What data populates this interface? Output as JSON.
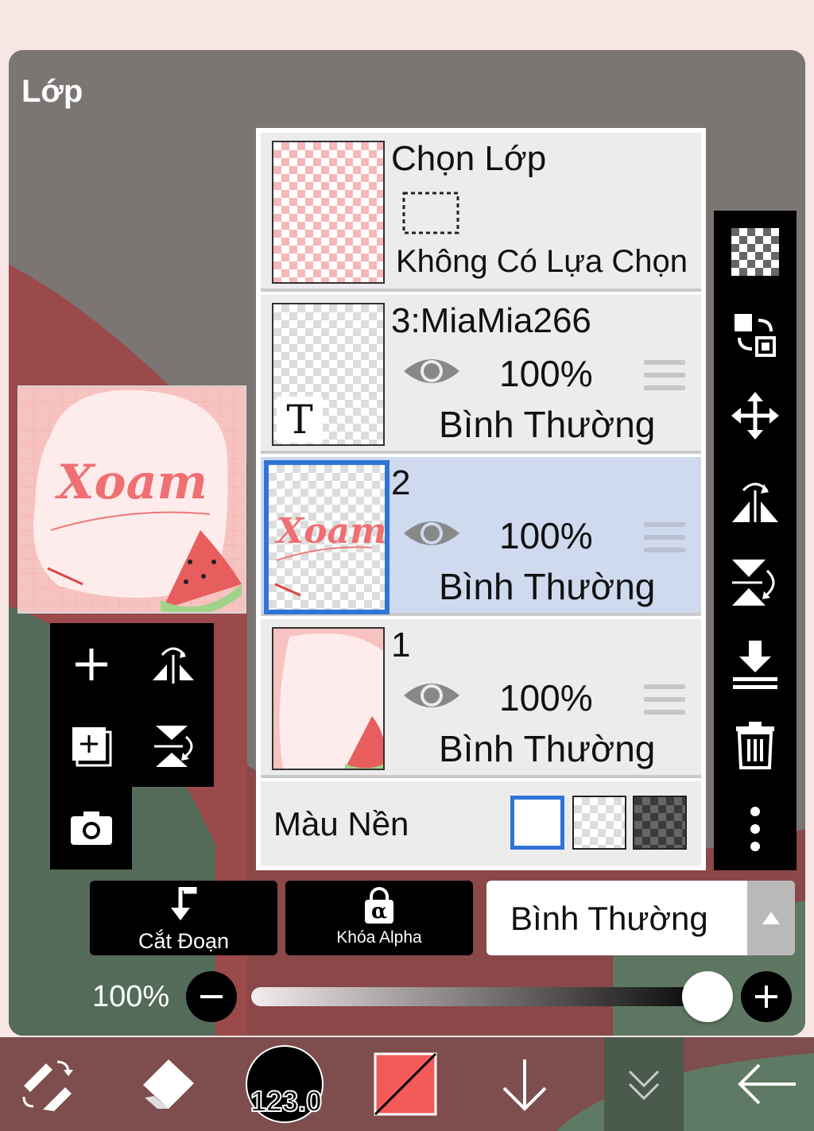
{
  "panel": {
    "title": "Lớp"
  },
  "selection_layer": {
    "title": "Chọn Lớp",
    "status": "Không Có Lựa Chọn"
  },
  "layers": [
    {
      "name": "3:MiaMia266",
      "opacity": "100%",
      "blend": "Bình Thường",
      "visible": true,
      "type_badge": "T",
      "selected": false
    },
    {
      "name": "2",
      "opacity": "100%",
      "blend": "Bình Thường",
      "visible": true,
      "selected": true
    },
    {
      "name": "1",
      "opacity": "100%",
      "blend": "Bình Thường",
      "visible": true,
      "selected": false
    }
  ],
  "background": {
    "label": "Màu Nền",
    "options": [
      "white",
      "transparent",
      "dark-checker"
    ],
    "selected": "white"
  },
  "actions": {
    "clip_label": "Cắt Đoạn",
    "alpha_lock_label": "Khóa Alpha",
    "alpha_glyph": "α"
  },
  "blend_mode": {
    "value": "Bình Thường"
  },
  "opacity": {
    "label": "100%",
    "value": 1.0
  },
  "bottom_bar": {
    "brush_size": "123.0",
    "items": [
      "transform-icon",
      "eraser-icon",
      "brush-size",
      "color-swatch",
      "arrow-down-icon",
      "collapse-icon",
      "back-arrow-icon"
    ]
  },
  "preview": {
    "text": "Xoam"
  },
  "colors": {
    "panel": "#7b7573",
    "selected_row": "#cfdaef",
    "accent": "#2f74d6",
    "primary_color": "#f25a5a",
    "toolbar": "#000000"
  }
}
